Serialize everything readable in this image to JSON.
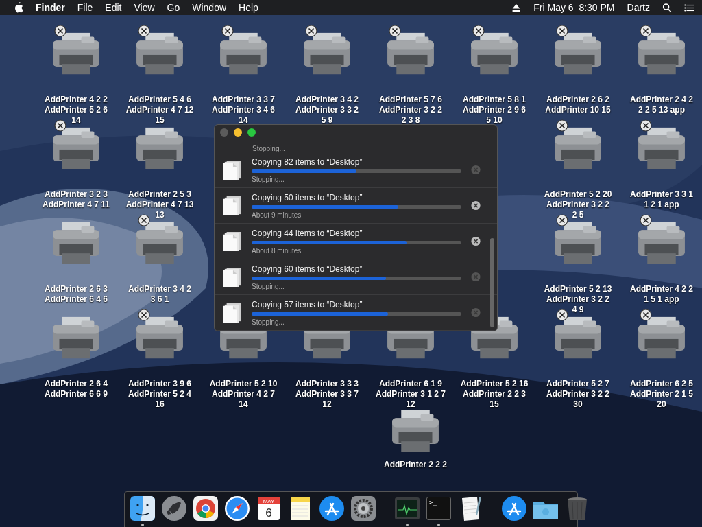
{
  "menu_bar": {
    "app": "Finder",
    "menus": [
      "File",
      "Edit",
      "View",
      "Go",
      "Window",
      "Help"
    ],
    "clock": "Fri May 6  8:30 PM",
    "user": "Dartz"
  },
  "desktop_icons": [
    {
      "label": "AddPrinter 4 2 2",
      "sublabel": "AddPrinter 5 2 6",
      "count": "14",
      "closable": true
    },
    {
      "label": "AddPrinter 5 4 6",
      "sublabel": "AddPrinter 4 7 12",
      "count": "15",
      "closable": true
    },
    {
      "label": "AddPrinter 3 3 7",
      "sublabel": "AddPrinter 3 4 6",
      "count": "14",
      "closable": true
    },
    {
      "label": "AddPrinter 3 4 2",
      "sublabel": "AddPrinter 3 3 2",
      "count": "5 9",
      "closable": true
    },
    {
      "label": "AddPrinter 5 7 6",
      "sublabel": "AddPrinter 3 2 2",
      "count": "2 3 8",
      "closable": true
    },
    {
      "label": "AddPrinter 5 8 1",
      "sublabel": "AddPrinter 2 9 6",
      "count": "5 10",
      "closable": true
    },
    {
      "label": "AddPrinter 2 6 2",
      "sublabel": "AddPrinter 10 15",
      "closable": true
    },
    {
      "label": "AddPrinter 2 4 2",
      "sublabel": "2 2 5 13 app",
      "closable": true
    },
    {
      "label": "AddPrinter 3 2 3",
      "sublabel": "AddPrinter 4 7 11",
      "closable": true
    },
    {
      "label": "AddPrinter 2 5 3",
      "sublabel": "AddPrinter 4 7 13",
      "count": "13",
      "closable": false
    },
    {
      "label": "AddPrinter 5 2 20",
      "sublabel": "AddPrinter 3 2 2",
      "count": "2 5",
      "closable": true
    },
    {
      "label": "AddPrinter 3 3 1",
      "sublabel": "1 2 1 app",
      "closable": true
    },
    {
      "label": "AddPrinter 2 6 3",
      "sublabel": "AddPrinter 6 4 6",
      "closable": false
    },
    {
      "label": "AddPrinter 3 4 2",
      "sublabel": "3 6 1",
      "closable": true
    },
    {
      "label": "AddPrinter 5 2 13",
      "sublabel": "AddPrinter 3 2 2",
      "count": "4 9",
      "closable": true
    },
    {
      "label": "AddPrinter 4 2 2",
      "sublabel": "1 5 1 app",
      "closable": true
    },
    {
      "label": "AddPrinter 2 6 4",
      "sublabel": "AddPrinter 6 6 9",
      "closable": false
    },
    {
      "label": "AddPrinter 3 9 6",
      "sublabel": "AddPrinter 5 2 4",
      "count": "16",
      "closable": true
    },
    {
      "label": "AddPrinter 5 2 10",
      "sublabel": "AddPrinter 4 2 7",
      "count": "14",
      "closable": false
    },
    {
      "label": "AddPrinter 3 3 3",
      "sublabel": "AddPrinter 3 3 7",
      "count": "12",
      "closable": false
    },
    {
      "label": "AddPrinter 6 1 9",
      "sublabel": "AddPrinter 3 1 2 7",
      "count": "12",
      "closable": false
    },
    {
      "label": "AddPrinter 5 2 16",
      "sublabel": "AddPrinter 2 2 3",
      "count": "15",
      "closable": false
    },
    {
      "label": "AddPrinter 5 2 7",
      "sublabel": "AddPrinter 3 2 2",
      "count": "30",
      "closable": true
    },
    {
      "label": "AddPrinter 6 2 5",
      "sublabel": "AddPrinter 2 1 5",
      "count": "20",
      "closable": true
    },
    {
      "label": "AddPrinter 2 2 2",
      "closable": false
    }
  ],
  "copy_window": {
    "partial_status": "Stopping...",
    "rows": [
      {
        "title": "Copying 82 items to “Desktop”",
        "level": 0.5,
        "status": "Stopping...",
        "cancel_enabled": false
      },
      {
        "title": "Copying 50 items to “Desktop”",
        "level": 0.7,
        "status": "About 9 minutes",
        "cancel_enabled": true
      },
      {
        "title": "Copying 44 items to “Desktop”",
        "level": 0.74,
        "status": "About 8 minutes",
        "cancel_enabled": true
      },
      {
        "title": "Copying 60 items to “Desktop”",
        "level": 0.64,
        "status": "Stopping...",
        "cancel_enabled": false
      },
      {
        "title": "Copying 57 items to “Desktop”",
        "level": 0.65,
        "status": "Stopping...",
        "cancel_enabled": false
      }
    ]
  },
  "dock": [
    {
      "kind": "finder",
      "running": true
    },
    {
      "kind": "launchpad",
      "running": false
    },
    {
      "kind": "chrome",
      "running": false
    },
    {
      "kind": "safari",
      "running": false
    },
    {
      "kind": "calendar",
      "running": false,
      "month": "MAY",
      "day": "6"
    },
    {
      "kind": "notes",
      "running": false
    },
    {
      "kind": "appstore",
      "running": false
    },
    {
      "kind": "preferences",
      "running": false
    },
    {
      "kind": "separator"
    },
    {
      "kind": "monitor",
      "running": true
    },
    {
      "kind": "terminal",
      "running": true,
      "prompt": ">_"
    },
    {
      "kind": "textedit",
      "running": false
    },
    {
      "kind": "separator"
    },
    {
      "kind": "appstore",
      "running": false
    },
    {
      "kind": "folder",
      "running": false
    },
    {
      "kind": "trash",
      "running": false
    }
  ]
}
